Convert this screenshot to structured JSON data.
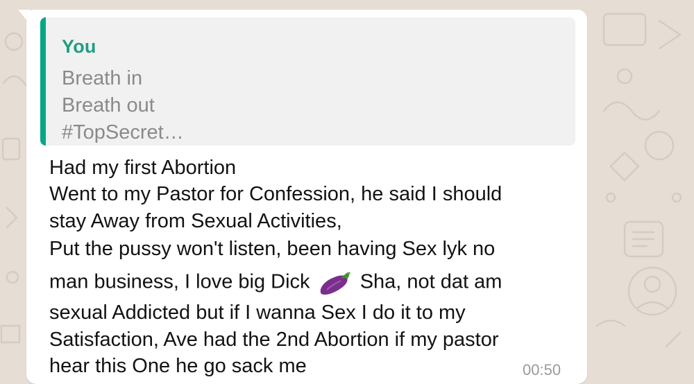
{
  "quoted": {
    "author": "You",
    "lines": [
      "Breath in",
      "Breath out",
      "#TopSecret…"
    ]
  },
  "message": {
    "lines": [
      "Had my first Abortion",
      "Went to my Pastor for Confession, he said I should",
      "stay Away from Sexual Activities,",
      "Put the pussy won't listen, been having Sex lyk no",
      "man business, I love big Dick",
      "Sha, not dat am",
      "sexual Addicted but if I wanna Sex I do it to my",
      "Satisfaction, Ave had the 2nd Abortion if my pastor",
      "hear this One he go sack me"
    ],
    "emoji_icon": "eggplant-emoji-icon",
    "time": "00:50"
  },
  "colors": {
    "wallpaper": "#e6ddd4",
    "bubble": "#ffffff",
    "quote_bg": "#f1f1f1",
    "quote_accent": "#06a884",
    "quote_author": "#1f9e81",
    "emoji": "#7a2f8c"
  }
}
